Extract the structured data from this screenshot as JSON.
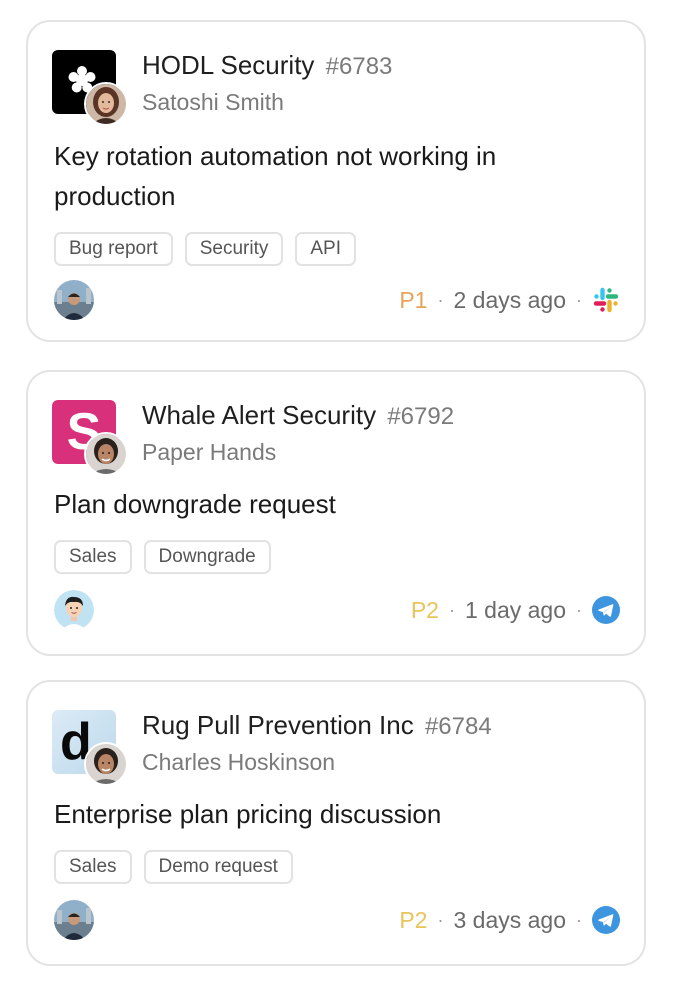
{
  "tickets": [
    {
      "company": "HODL Security",
      "number": "#6783",
      "contact": "Satoshi Smith",
      "subject": "Key rotation automation not working in production",
      "tags": [
        "Bug report",
        "Security",
        "API"
      ],
      "priority": "P1",
      "priority_color": "#e8a25a",
      "age": "2 days ago",
      "channel_icon": "slack-icon"
    },
    {
      "company": "Whale Alert Security",
      "number": "#6792",
      "contact": "Paper Hands",
      "logo_letter": "S",
      "subject": "Plan downgrade request",
      "tags": [
        "Sales",
        "Downgrade"
      ],
      "priority": "P2",
      "priority_color": "#e8c45a",
      "age": "1 day ago",
      "channel_icon": "telegram-icon"
    },
    {
      "company": "Rug Pull Prevention Inc",
      "number": "#6784",
      "contact": "Charles Hoskinson",
      "logo_letter": "d",
      "subject": "Enterprise plan pricing discussion",
      "tags": [
        "Sales",
        "Demo request"
      ],
      "priority": "P2",
      "priority_color": "#e8c45a",
      "age": "3 days ago",
      "channel_icon": "telegram-icon"
    }
  ],
  "separator": "·"
}
